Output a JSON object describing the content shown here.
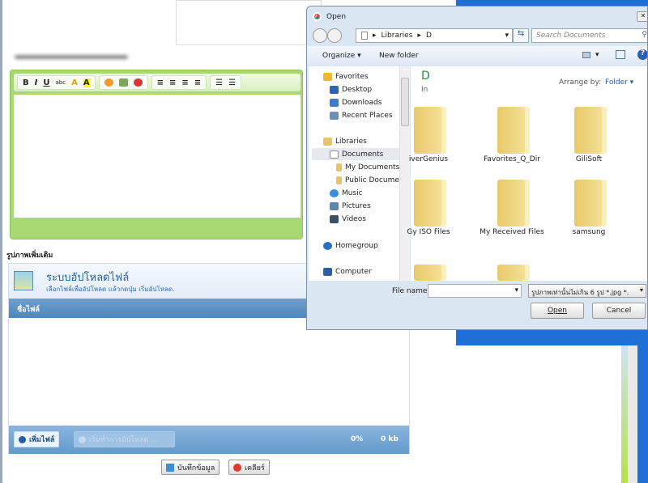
{
  "editor": {
    "toolbar": [
      "B",
      "I",
      "U",
      "abc",
      "A",
      "A"
    ]
  },
  "upload": {
    "section_label": "รูปภาพเพิ่มเติม",
    "title": "ระบบอัปโหลดไฟล์",
    "subtitle": "เลือกไฟล์เพื่ออัปโหลด แล้วกดปุ่ม เริ่มอัปโหลด.",
    "column_filename": "ชื่อไฟล์",
    "add_file": "เพิ่มไฟล์",
    "start_upload": "เริ่มทำการอัปโหลด ...",
    "percent": "0%",
    "size": "0 kb"
  },
  "actions": {
    "save": "บันทึกข้อมูล",
    "clear": "เคลียร์"
  },
  "dialog": {
    "title": "Open",
    "breadcrumb": [
      "Libraries",
      "D"
    ],
    "search_placeholder": "Search Documents",
    "organize": "Organize ▾",
    "new_folder": "New folder",
    "content_title": "D",
    "content_sub": "In",
    "arrange_label": "Arrange by:",
    "arrange_value": "Folder ▾",
    "nav": [
      "Favorites",
      "Desktop",
      "Downloads",
      "Recent Places",
      "Libraries",
      "Documents",
      "My Documents",
      "Public Docume",
      "Music",
      "Pictures",
      "Videos",
      "Homegroup",
      "Computer"
    ],
    "folders": [
      "iverGenius",
      "Favorites_Q_Dir",
      "GiliSoft",
      "Gy ISO Files",
      "My Received Files",
      "samsung"
    ],
    "filename_label": "File name:",
    "filename_value": "",
    "filter": "รูปภาพเท่านั้นไม่เกิน 6 รูป *.jpg *.",
    "open": "Open",
    "cancel": "Cancel"
  }
}
